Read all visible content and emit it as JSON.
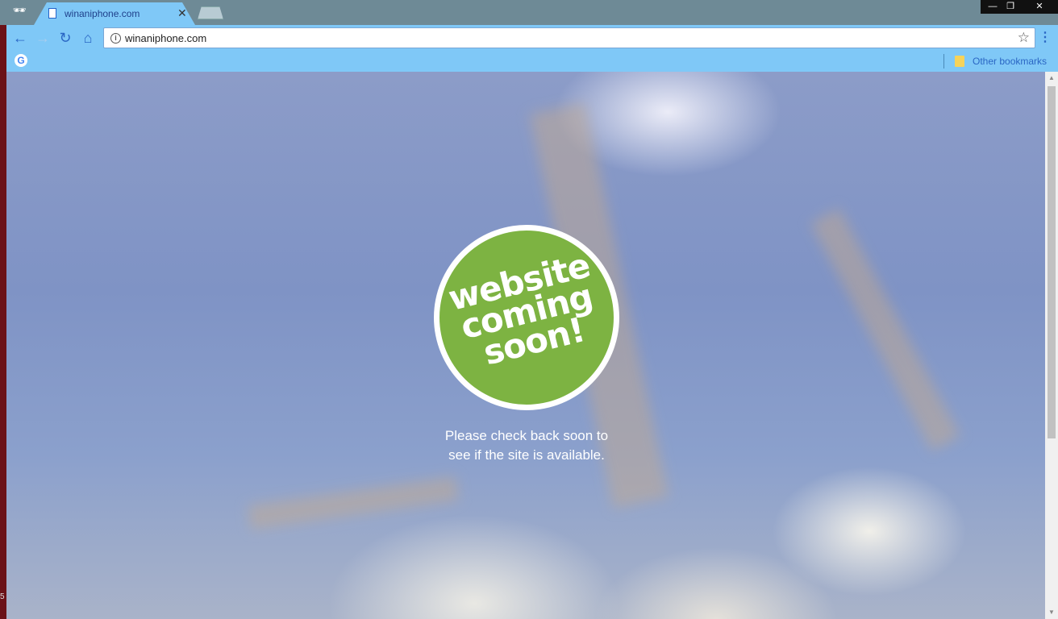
{
  "browser": {
    "tab": {
      "title": "winaniphone.com"
    },
    "address_bar": {
      "url": "winaniphone.com"
    },
    "bookmarks_bar": {
      "other_bookmarks": "Other bookmarks"
    },
    "window_controls": {
      "minimize": "—",
      "restore": "❐",
      "close": "✕"
    }
  },
  "page": {
    "badge": {
      "line1": "website",
      "line2": "coming",
      "line3": "soon!"
    },
    "message": {
      "line1": "Please check back soon to",
      "line2": "see if the site is available."
    }
  },
  "desktop": {
    "edge_number": "5"
  },
  "colors": {
    "badge_green": "#7db342",
    "chrome_accent": "#7fc8f7",
    "titlebar": "#6e8a96"
  },
  "icons": [
    "incognito-icon",
    "page-icon",
    "close-icon",
    "back-icon",
    "forward-icon",
    "reload-icon",
    "home-icon",
    "info-icon",
    "star-icon",
    "menu-icon",
    "google-icon",
    "folder-icon"
  ]
}
